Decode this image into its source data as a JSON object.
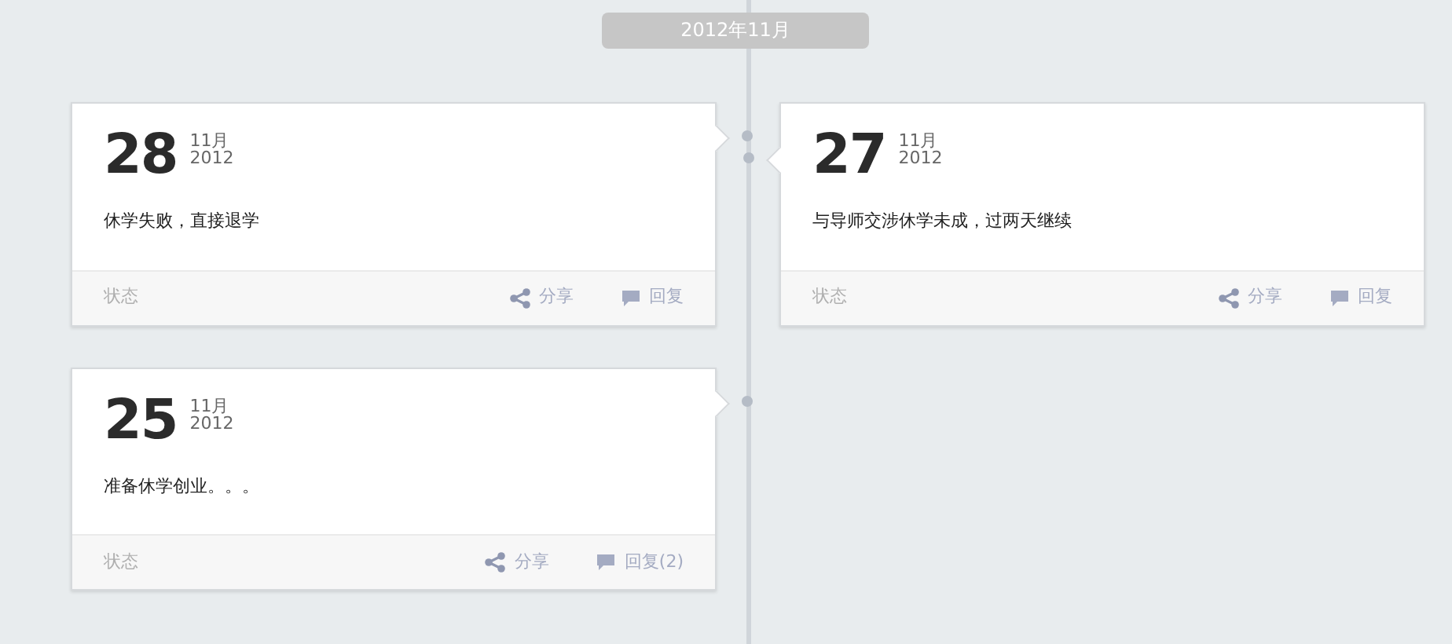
{
  "month_header": "2012年11月",
  "posts": [
    {
      "kind": "left",
      "day": "28",
      "month": "11月",
      "year": "2012",
      "text": "休学失败，直接退学",
      "status": "状态",
      "share": "分享",
      "reply": "回复"
    },
    {
      "kind": "right",
      "day": "27",
      "month": "11月",
      "year": "2012",
      "text": "与导师交涉休学未成，过两天继续",
      "status": "状态",
      "share": "分享",
      "reply": "回复"
    },
    {
      "kind": "left",
      "day": "25",
      "month": "11月",
      "year": "2012",
      "text": "准备休学创业。。。",
      "status": "状态",
      "share": "分享",
      "reply": "回复(2)"
    }
  ]
}
